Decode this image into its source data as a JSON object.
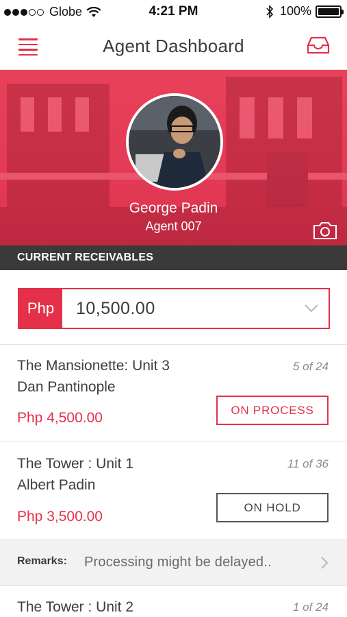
{
  "status_bar": {
    "carrier": "Globe",
    "time": "4:21 PM",
    "battery": "100%",
    "icons": [
      "signal-icon",
      "wifi-icon",
      "bluetooth-icon",
      "battery-icon"
    ]
  },
  "nav": {
    "title": "Agent Dashboard",
    "icons": [
      "menu-icon",
      "inbox-icon"
    ]
  },
  "profile": {
    "name": "George Padin",
    "role": "Agent 007",
    "icons": [
      "camera-icon"
    ]
  },
  "receivables": {
    "section_title": "CURRENT RECEIVABLES",
    "currency": "Php",
    "amount": "10,500.00"
  },
  "items": [
    {
      "title": "The Mansionette: Unit 3",
      "client": "Dan Pantinople",
      "amount": "Php 4,500.00",
      "count": "5 of 24",
      "status": "ON PROCESS"
    },
    {
      "title": "The Tower : Unit 1",
      "client": "Albert Padin",
      "amount": "Php 3,500.00",
      "count": "11 of 36",
      "status": "ON HOLD",
      "remarks_label": "Remarks:",
      "remarks_text": "Processing might be delayed.."
    },
    {
      "title": "The Tower : Unit 2",
      "count": "1 of 24"
    }
  ],
  "colors": {
    "accent": "#e5304a",
    "section_header_bg": "#3a3a3a",
    "remarks_bg": "#f2f2f2"
  }
}
